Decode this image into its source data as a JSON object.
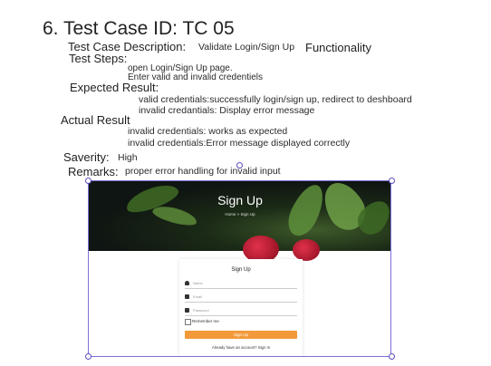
{
  "heading": "6. Test Case ID: TC 05",
  "description": {
    "label": "Test Case Description:",
    "value": "Validate Login/Sign Up",
    "suffix": "Functionality"
  },
  "steps": {
    "label": "Test Steps:",
    "items": [
      "open Login/Sign Up page.",
      "Enter valid and invalid credentiels"
    ]
  },
  "expected": {
    "label": "Expected Result:",
    "items": [
      "valid credentials:successfully login/sign up, redirect to deshboard",
      "invalid credantials: Display error message"
    ]
  },
  "actual": {
    "label": "Actual Result",
    "items": [
      "invalid credentials: works as expected",
      "invalid credentials:Error message displayed correctly"
    ]
  },
  "severity": {
    "label": "Saverity:",
    "value": "High"
  },
  "remarks": {
    "label": "Remarks:",
    "value": "proper error handling for invalid input"
  },
  "screenshot": {
    "hero_title": "Sign Up",
    "breadcrumb": "Home > Sign Up",
    "card_title": "Sign Up",
    "name_placeholder": "Name",
    "email_placeholder": "Email",
    "password_placeholder": "Password",
    "remember_label": "Remember me",
    "button_label": "Sign Up",
    "have_account": "Already have an account? Sign In"
  },
  "colors": {
    "accent": "#f29a3a",
    "selection": "#7b6fd6"
  }
}
